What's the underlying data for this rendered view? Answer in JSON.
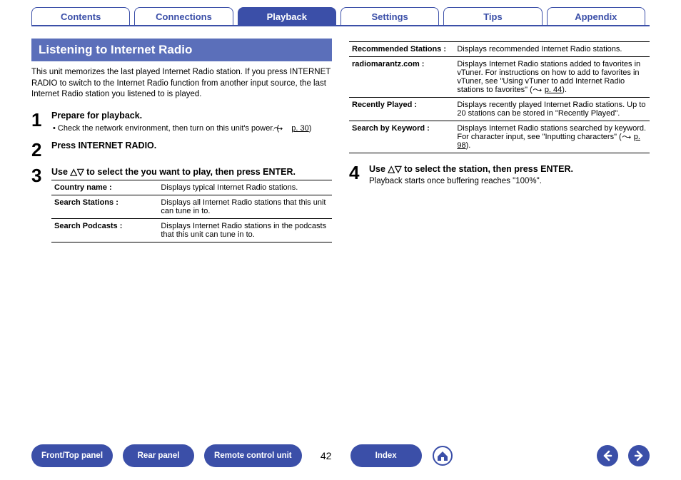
{
  "tabs": {
    "contents": "Contents",
    "connections": "Connections",
    "playback": "Playback",
    "settings": "Settings",
    "tips": "Tips",
    "appendix": "Appendix"
  },
  "section_title": "Listening to Internet Radio",
  "intro": "This unit memorizes the last played Internet Radio station. If you press INTERNET RADIO to switch to the Internet Radio function from another input source, the last Internet Radio station you listened to is played.",
  "steps": {
    "s1": {
      "num": "1",
      "title": "Prepare for playback.",
      "sub_a": "Check the network environment, then turn on this unit's power. (",
      "sub_link": "p. 30",
      "sub_b": ")"
    },
    "s2": {
      "num": "2",
      "title": "Press INTERNET RADIO."
    },
    "s3": {
      "num": "3",
      "title": "Use △▽ to select the you want to play, then press ENTER."
    },
    "s4": {
      "num": "4",
      "title": "Use △▽ to select the station, then press ENTER.",
      "sub": "Playback starts once buffering reaches \"100%\"."
    }
  },
  "table_left": [
    {
      "label": "Country name :",
      "desc": "Displays typical Internet Radio stations."
    },
    {
      "label": "Search Stations :",
      "desc": "Displays all Internet Radio stations that this unit can tune in to."
    },
    {
      "label": "Search Podcasts :",
      "desc": "Displays Internet Radio stations in the podcasts that this unit can tune in to."
    }
  ],
  "table_right": [
    {
      "label": "Recommended Stations :",
      "desc": "Displays recommended Internet Radio stations."
    },
    {
      "label": "radiomarantz.com :",
      "desc_a": "Displays Internet Radio stations added to favorites in vTuner. For instructions on how to add to favorites in vTuner, see \"Using vTuner to add Internet Radio stations to favorites\" (",
      "link": "p. 44",
      "desc_b": ")."
    },
    {
      "label": "Recently Played :",
      "desc": "Displays recently played Internet Radio stations. Up to 20 stations can be stored in \"Recently Played\"."
    },
    {
      "label": "Search by Keyword :",
      "desc_a": "Displays Internet Radio stations searched by keyword. For character input, see \"Inputting characters\" (",
      "link": "p. 98",
      "desc_b": ")."
    }
  ],
  "bottom": {
    "fronttop": "Front/Top panel",
    "rear": "Rear panel",
    "remote": "Remote control unit",
    "page": "42",
    "index": "Index"
  }
}
